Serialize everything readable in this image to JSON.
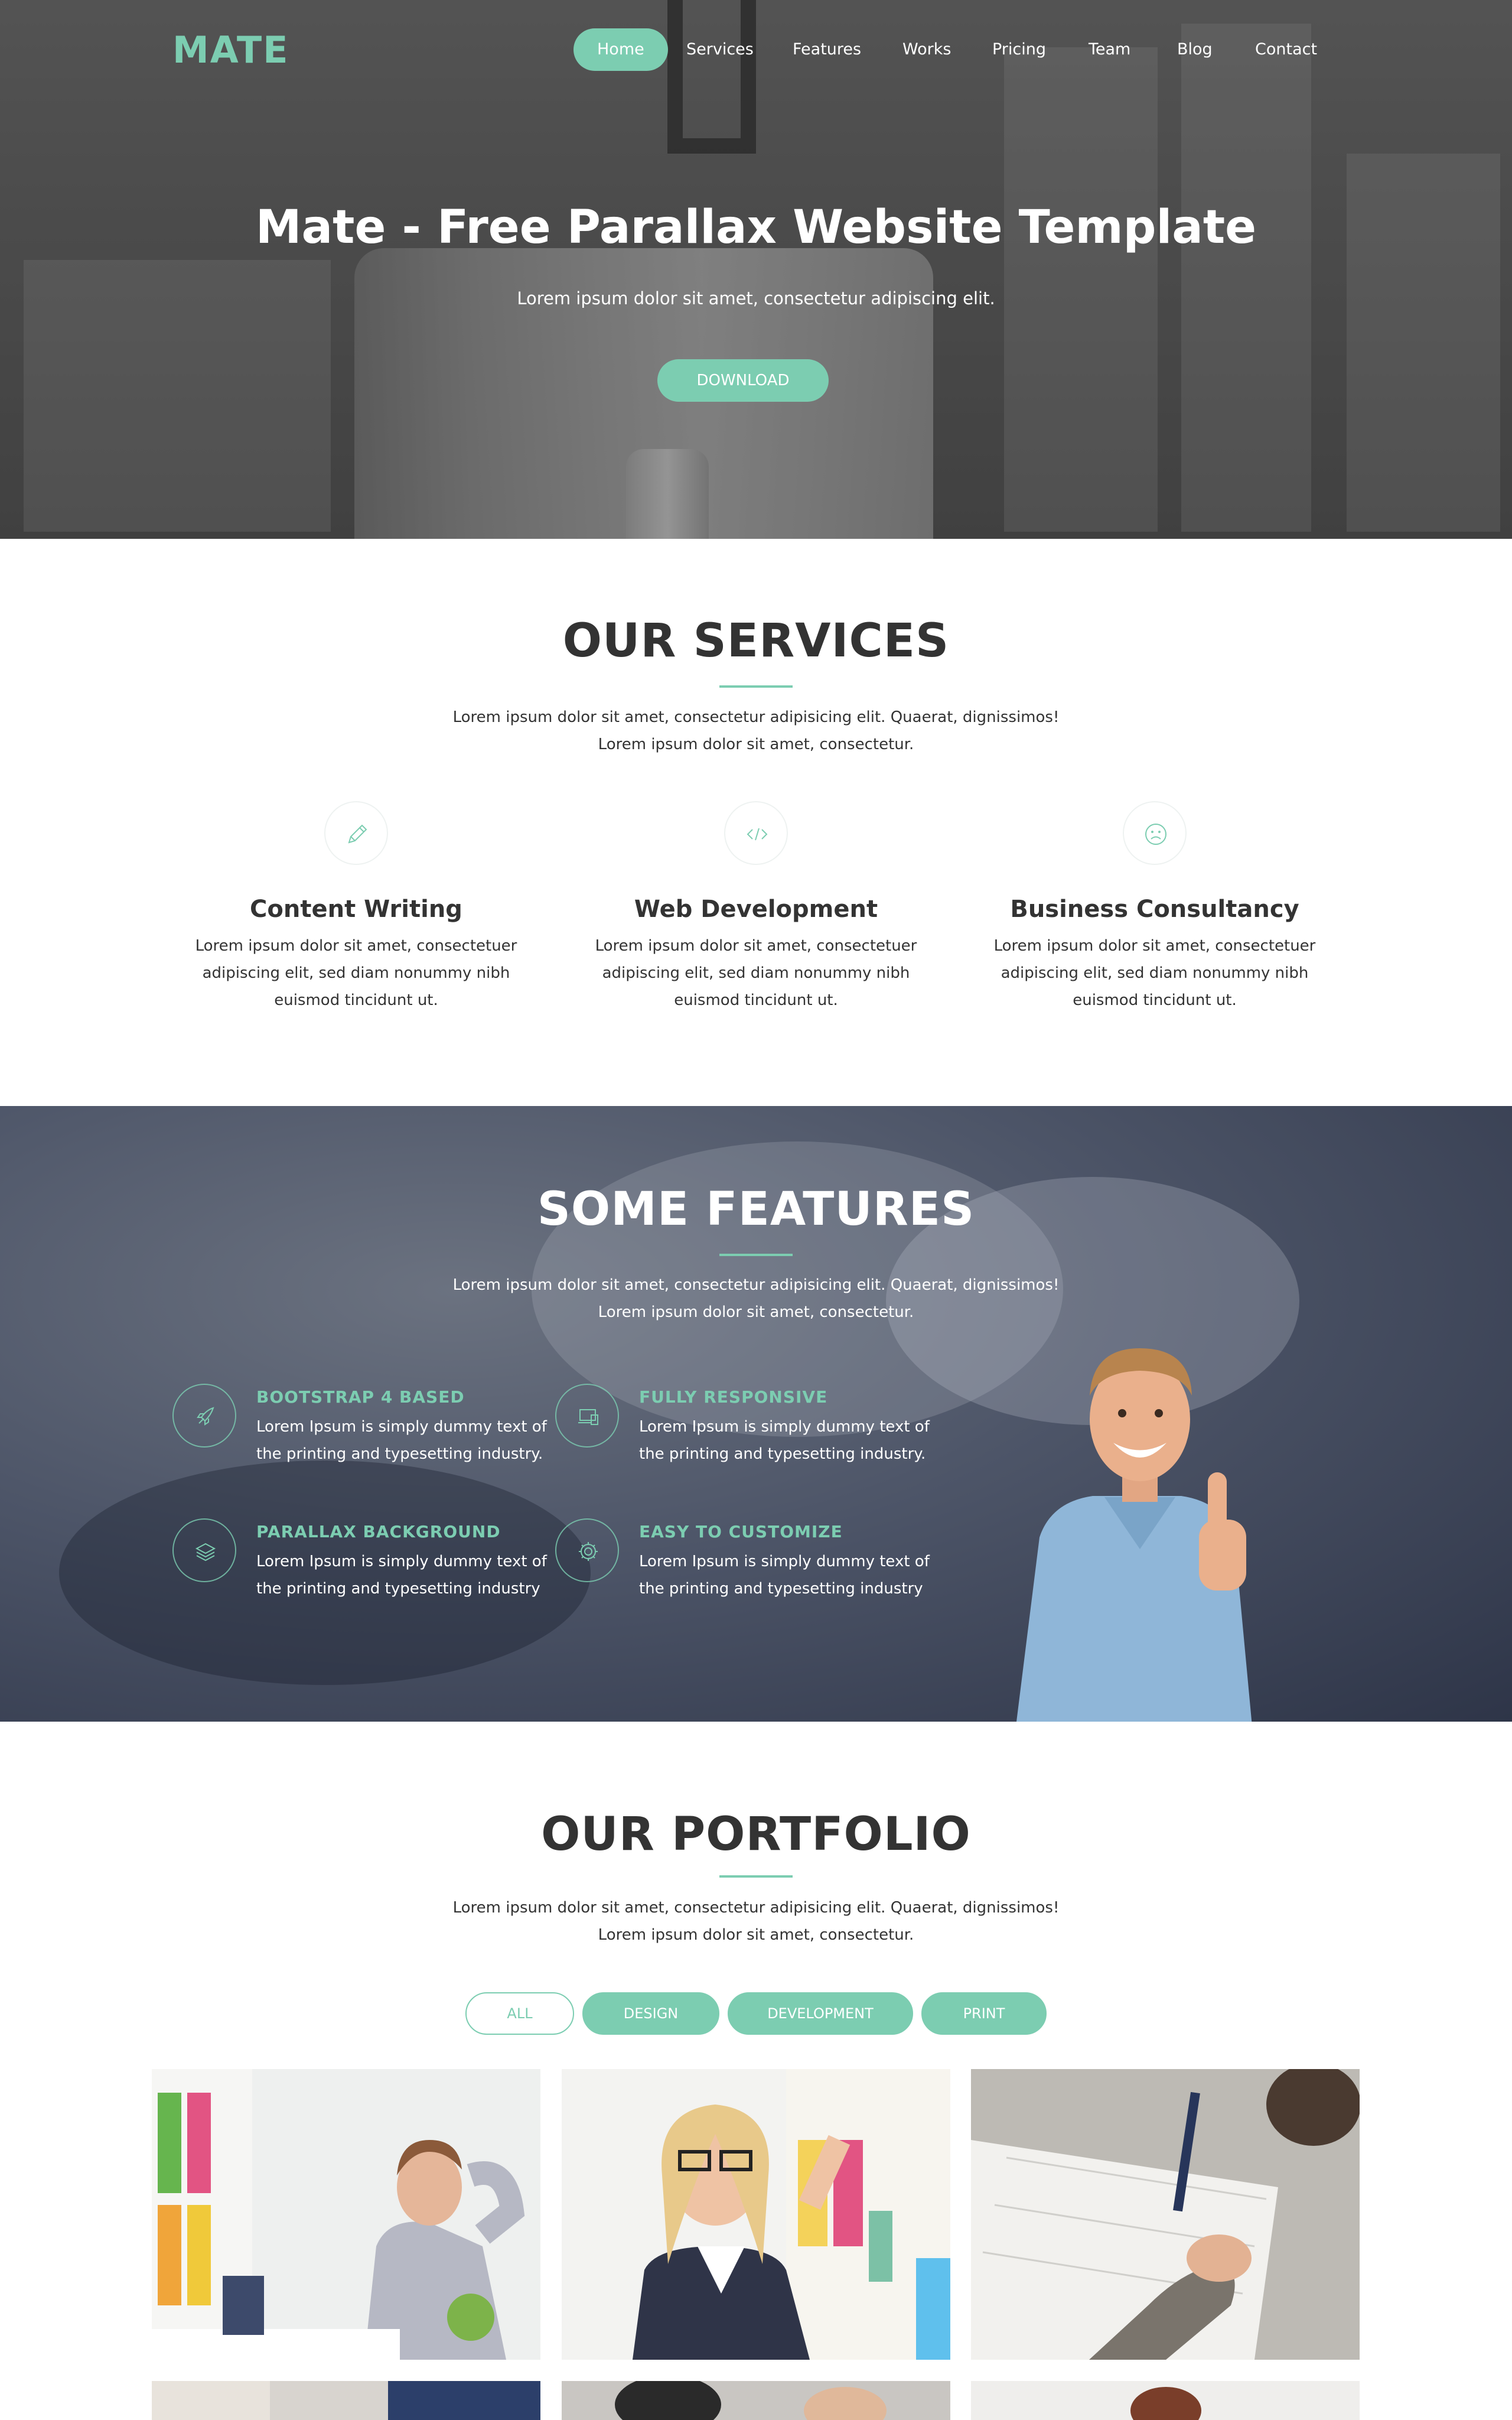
{
  "brand": {
    "logo": "MATE",
    "accent": "#7ccdb1"
  },
  "nav": {
    "items": [
      {
        "label": "Home",
        "active": true
      },
      {
        "label": "Services"
      },
      {
        "label": "Features"
      },
      {
        "label": "Works"
      },
      {
        "label": "Pricing"
      },
      {
        "label": "Team"
      },
      {
        "label": "Blog"
      },
      {
        "label": "Contact"
      }
    ]
  },
  "hero": {
    "title": "Mate - Free Parallax Website Template",
    "subtitle": "Lorem ipsum dolor sit amet, consectetur adipiscing elit.",
    "button": "DOWNLOAD"
  },
  "services": {
    "title": "OUR SERVICES",
    "desc_line1": "Lorem ipsum dolor sit amet, consectetur adipisicing elit. Quaerat, dignissimos!",
    "desc_line2": "Lorem ipsum dolor sit amet, consectetur.",
    "items": [
      {
        "icon": "pencil-icon",
        "title": "Content Writing",
        "line1": "Lorem ipsum dolor sit amet, consectetuer",
        "line2": "adipiscing elit, sed diam nonummy nibh",
        "line3": "euismod tincidunt ut."
      },
      {
        "icon": "code-icon",
        "title": "Web Development",
        "line1": "Lorem ipsum dolor sit amet, consectetuer",
        "line2": "adipiscing elit, sed diam nonummy nibh",
        "line3": "euismod tincidunt ut."
      },
      {
        "icon": "face-icon",
        "title": "Business Consultancy",
        "line1": "Lorem ipsum dolor sit amet, consectetuer",
        "line2": "adipiscing elit, sed diam nonummy nibh",
        "line3": "euismod tincidunt ut."
      }
    ]
  },
  "features": {
    "title": "SOME FEATURES",
    "desc_line1": "Lorem ipsum dolor sit amet, consectetur adipisicing elit. Quaerat, dignissimos!",
    "desc_line2": "Lorem ipsum dolor sit amet, consectetur.",
    "items": [
      {
        "icon": "rocket-icon",
        "title": "BOOTSTRAP 4 BASED",
        "line1": "Lorem Ipsum is simply dummy text of",
        "line2": "the printing and typesetting industry."
      },
      {
        "icon": "devices-icon",
        "title": "FULLY RESPONSIVE",
        "line1": "Lorem Ipsum is simply dummy text of",
        "line2": "the printing and typesetting industry."
      },
      {
        "icon": "layers-icon",
        "title": "PARALLAX BACKGROUND",
        "line1": "Lorem Ipsum is simply dummy text of",
        "line2": "the printing and typesetting industry"
      },
      {
        "icon": "gear-icon",
        "title": "EASY TO CUSTOMIZE",
        "line1": "Lorem Ipsum is simply dummy text of",
        "line2": "the printing and typesetting industry"
      }
    ]
  },
  "portfolio": {
    "title": "OUR PORTFOLIO",
    "desc_line1": "Lorem ipsum dolor sit amet, consectetur adipisicing elit. Quaerat, dignissimos!",
    "desc_line2": "Lorem ipsum dolor sit amet, consectetur.",
    "filters": [
      {
        "label": "ALL",
        "active": true
      },
      {
        "label": "DESIGN"
      },
      {
        "label": "DEVELOPMENT"
      },
      {
        "label": "PRINT"
      }
    ]
  }
}
